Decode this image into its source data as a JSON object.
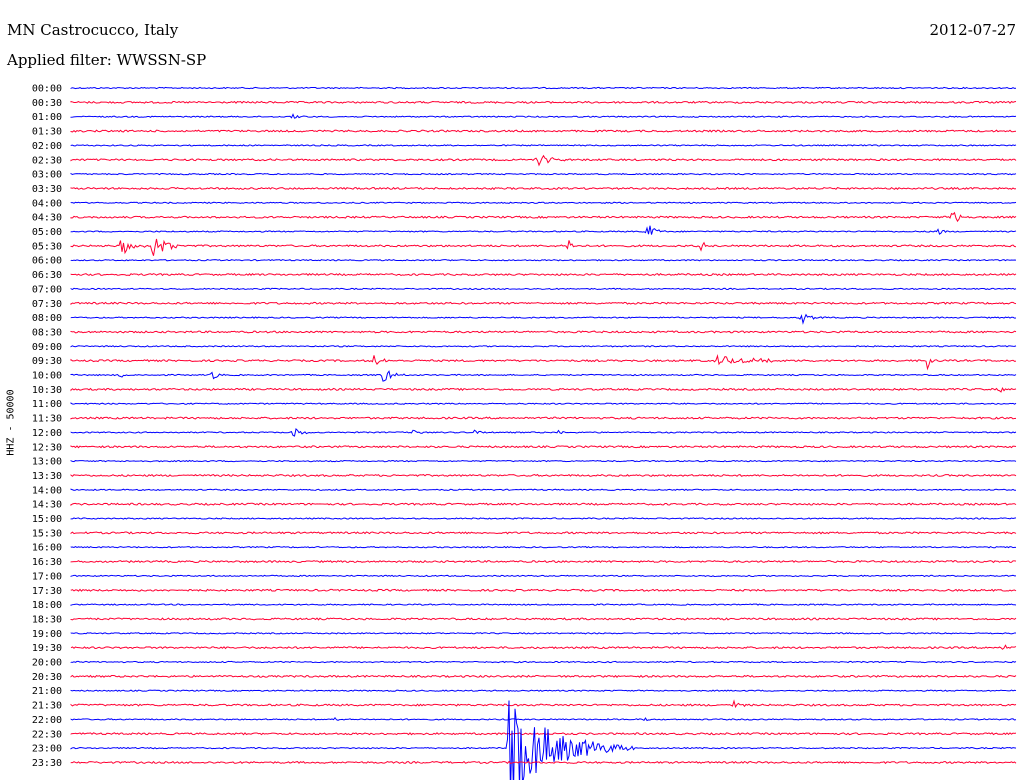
{
  "header": {
    "station": "MN Castrocucco, Italy",
    "date": "2012-07-27",
    "filter": "Applied filter: WWSSN-SP"
  },
  "colors": {
    "blue": "#0000ff",
    "red": "#ff0033"
  },
  "chart_data": {
    "type": "line",
    "ylabel": "HHZ - 50000",
    "ticks": [
      "00:00",
      "00:30",
      "01:00",
      "01:30",
      "02:00",
      "02:30",
      "03:00",
      "03:30",
      "04:00",
      "04:30",
      "05:00",
      "05:30",
      "06:00",
      "06:30",
      "07:00",
      "07:30",
      "08:00",
      "08:30",
      "09:00",
      "09:30",
      "10:00",
      "10:30",
      "11:00",
      "11:30",
      "12:00",
      "12:30",
      "13:00",
      "13:30",
      "14:00",
      "14:30",
      "15:00",
      "15:30",
      "16:00",
      "16:30",
      "17:00",
      "17:30",
      "18:00",
      "18:30",
      "19:00",
      "19:30",
      "20:00",
      "20:30",
      "21:00",
      "21:30",
      "22:00",
      "22:30",
      "23:00",
      "23:30"
    ],
    "x_range_minutes": [
      0,
      30
    ],
    "trace_colors": [
      "blue",
      "red"
    ],
    "events": [
      {
        "trace": "01:00",
        "minute": 7.0,
        "amplitude": 0.25,
        "duration_min": 0.5
      },
      {
        "trace": "02:30",
        "minute": 14.8,
        "amplitude": 0.5,
        "duration_min": 1.0
      },
      {
        "trace": "04:30",
        "minute": 28.0,
        "amplitude": 0.7,
        "duration_min": 0.6
      },
      {
        "trace": "05:00",
        "minute": 18.3,
        "amplitude": 0.6,
        "duration_min": 0.6
      },
      {
        "trace": "05:00",
        "minute": 27.5,
        "amplitude": 0.45,
        "duration_min": 0.4
      },
      {
        "trace": "05:30",
        "minute": 1.6,
        "amplitude": 0.7,
        "duration_min": 0.8
      },
      {
        "trace": "05:30",
        "minute": 2.6,
        "amplitude": 1.0,
        "duration_min": 1.0
      },
      {
        "trace": "05:30",
        "minute": 15.8,
        "amplitude": 0.6,
        "duration_min": 0.4
      },
      {
        "trace": "05:30",
        "minute": 20.0,
        "amplitude": 0.35,
        "duration_min": 0.4
      },
      {
        "trace": "08:00",
        "minute": 23.2,
        "amplitude": 0.5,
        "duration_min": 0.8
      },
      {
        "trace": "09:30",
        "minute": 9.6,
        "amplitude": 0.45,
        "duration_min": 0.6
      },
      {
        "trace": "09:30",
        "minute": 20.5,
        "amplitude": 0.35,
        "duration_min": 3.0
      },
      {
        "trace": "09:30",
        "minute": 27.2,
        "amplitude": 0.8,
        "duration_min": 0.3
      },
      {
        "trace": "10:00",
        "minute": 9.9,
        "amplitude": 0.6,
        "duration_min": 0.8
      },
      {
        "trace": "10:00",
        "minute": 4.5,
        "amplitude": 0.35,
        "duration_min": 0.5
      },
      {
        "trace": "10:00",
        "minute": 1.5,
        "amplitude": 0.3,
        "duration_min": 0.5
      },
      {
        "trace": "10:30",
        "minute": 29.5,
        "amplitude": 0.25,
        "duration_min": 0.3
      },
      {
        "trace": "12:00",
        "minute": 7.0,
        "amplitude": 0.45,
        "duration_min": 0.7
      },
      {
        "trace": "12:00",
        "minute": 10.9,
        "amplitude": 0.3,
        "duration_min": 0.4
      },
      {
        "trace": "12:00",
        "minute": 12.8,
        "amplitude": 0.3,
        "duration_min": 0.5
      },
      {
        "trace": "12:00",
        "minute": 15.5,
        "amplitude": 0.2,
        "duration_min": 0.3
      },
      {
        "trace": "19:30",
        "minute": 29.6,
        "amplitude": 0.45,
        "duration_min": 0.4
      },
      {
        "trace": "21:30",
        "minute": 21.0,
        "amplitude": 0.4,
        "duration_min": 0.5
      },
      {
        "trace": "22:00",
        "minute": 8.4,
        "amplitude": 0.3,
        "duration_min": 0.15
      },
      {
        "trace": "22:00",
        "minute": 18.2,
        "amplitude": 0.3,
        "duration_min": 0.15
      },
      {
        "trace": "23:00",
        "minute": 13.9,
        "amplitude": 3.5,
        "duration_min": 4.0
      }
    ]
  }
}
